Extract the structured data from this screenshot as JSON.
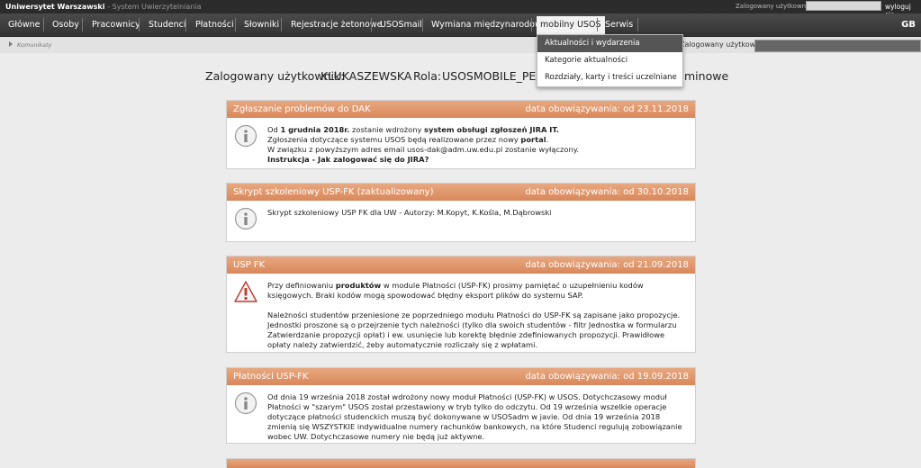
{
  "topbar": {
    "brand": "Uniwersytet Warszawski",
    "system": "- System Uwierzytelniania",
    "login_label": "Zalogowany użytkownik:",
    "logout": "wyloguj się"
  },
  "nav": {
    "items": [
      "Główne",
      "Osoby",
      "Pracownicy",
      "Studenci",
      "Płatności",
      "Słowniki",
      "Rejestracje żetonowe",
      "USOSmail",
      "Wymiana międzynarodowa",
      "mobilny USOS",
      "Serwis"
    ],
    "lang": "GB"
  },
  "crumbs": {
    "text": "Komunikaty",
    "login_label": "Zalogowany użytkownik:"
  },
  "dropdown": {
    "items": [
      "Aktualności i wydarzenia",
      "Kategorie aktualności",
      "Rozdziały, karty i treści uczelniane"
    ]
  },
  "userline": {
    "login_label": "Zalogowany użytkownik:",
    "login_value": "KLUKASZEWSKA",
    "role_label": "Rola:",
    "role_value": "USOSMOBILE_PELNA",
    "role_suffix": "minowe"
  },
  "cards": [
    {
      "title": "Zgłaszanie problemów do DAK",
      "date": "data obowiązywania: od 23.11.2018",
      "icon": "info-icon",
      "l1a": "Od ",
      "l1b": "1 grudnia 2018r.",
      "l1c": " zostanie wdrożony ",
      "l1d": "system obsługi zgłoszeń JIRA IT.",
      "l2a": "Zgłoszenia dotyczące systemu USOS będą realizowane przez nowy ",
      "l2b": "portal",
      "l3": "W związku z powyższym adres email usos-dak@adm.uw.edu.pl zostanie wyłączony.",
      "l4": "Instrukcja - Jak zalogować się do JIRA?"
    },
    {
      "title": "Skrypt szkoleniowy USP-FK (zaktualizowany)",
      "date": "data obowiązywania: od 30.10.2018",
      "icon": "info-icon",
      "text": "Skrypt szkoleniowy USP FK dla UW - Autorzy: M.Kopyt, K.Kośla, M.Dąbrowski"
    },
    {
      "title": "USP FK",
      "date": "data obowiązywania: od 21.09.2018",
      "icon": "warning-icon",
      "p1a": "Przy definiowaniu ",
      "p1b": "produktów",
      "p1c": " w module Płatności (USP-FK) prosimy pamiętać o uzupełnieniu kodów księgowych. Braki kodów mogą spowodować błędny eksport plików do systemu SAP.",
      "p2": "Należności studentów przeniesione ze poprzedniego modułu Płatności do USP-FK są zapisane jako propozycje. Jednostki proszone są o przejrzenie tych należności (tylko dla swoich studentów - filtr Jednostka w formularzu Zatwierdzanie propozycji opłat) i ew. usunięcie lub korektę błędnie zdefiniowanych propozycji. Prawidłowe opłaty należy zatwierdzić, żeby automatycznie rozliczały się z wpłatami."
    },
    {
      "title": "Płatności USP-FK",
      "date": "data obowiązywania: od 19.09.2018",
      "icon": "info-icon",
      "text": "Od dnia 19 września 2018 został wdrożony nowy moduł Płatności (USP-FK) w USOS. Dotychczasowy moduł Płatności w \"szarym\" USOS został przestawiony w tryb tylko do odczytu. Od 19 września wszelkie operacje dotyczące płatności studenckich muszą być dokonywane w USOSadm w javie. Od dnia 19 września 2018 zmienią się WSZYSTKIE indywidualne numery rachunków bankowych, na które Studenci regulują zobowiązanie wobec UW. Dotychczasowe numery nie będą już aktywne."
    }
  ]
}
